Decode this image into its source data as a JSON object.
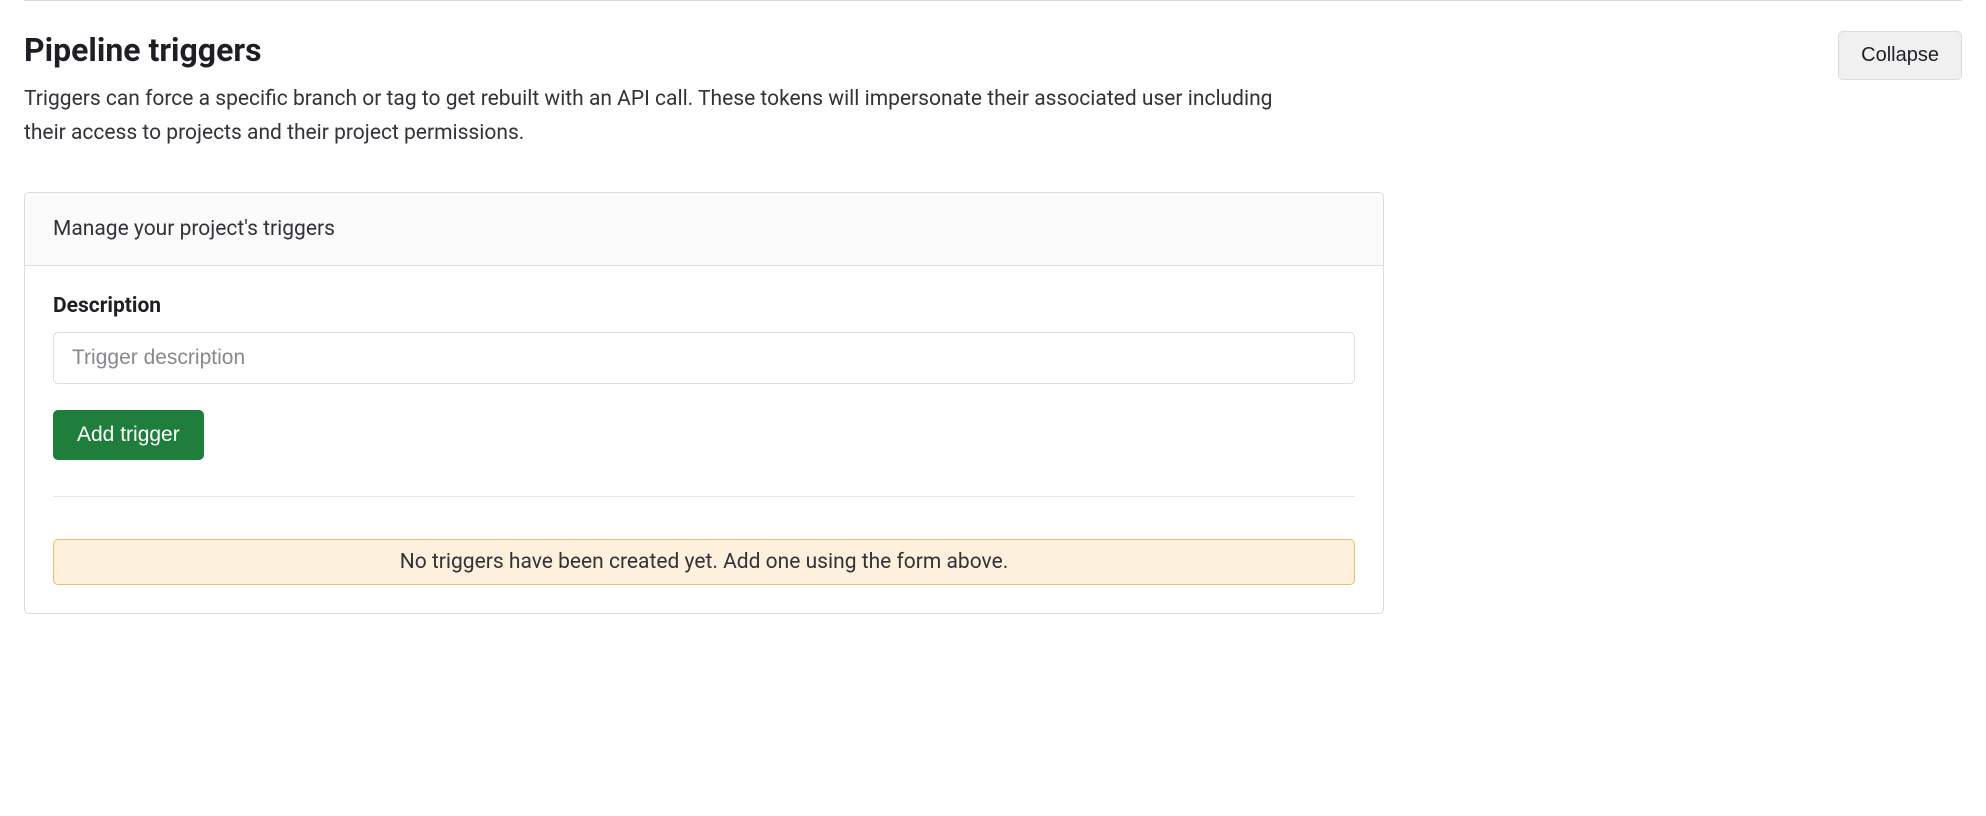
{
  "section": {
    "title": "Pipeline triggers",
    "description": "Triggers can force a specific branch or tag to get rebuilt with an API call. These tokens will impersonate their associated user including their access to projects and their project permissions.",
    "collapse_label": "Collapse"
  },
  "card": {
    "header": "Manage your project's triggers",
    "description_label": "Description",
    "description_placeholder": "Trigger description",
    "add_button_label": "Add trigger",
    "empty_message": "No triggers have been created yet. Add one using the form above."
  }
}
